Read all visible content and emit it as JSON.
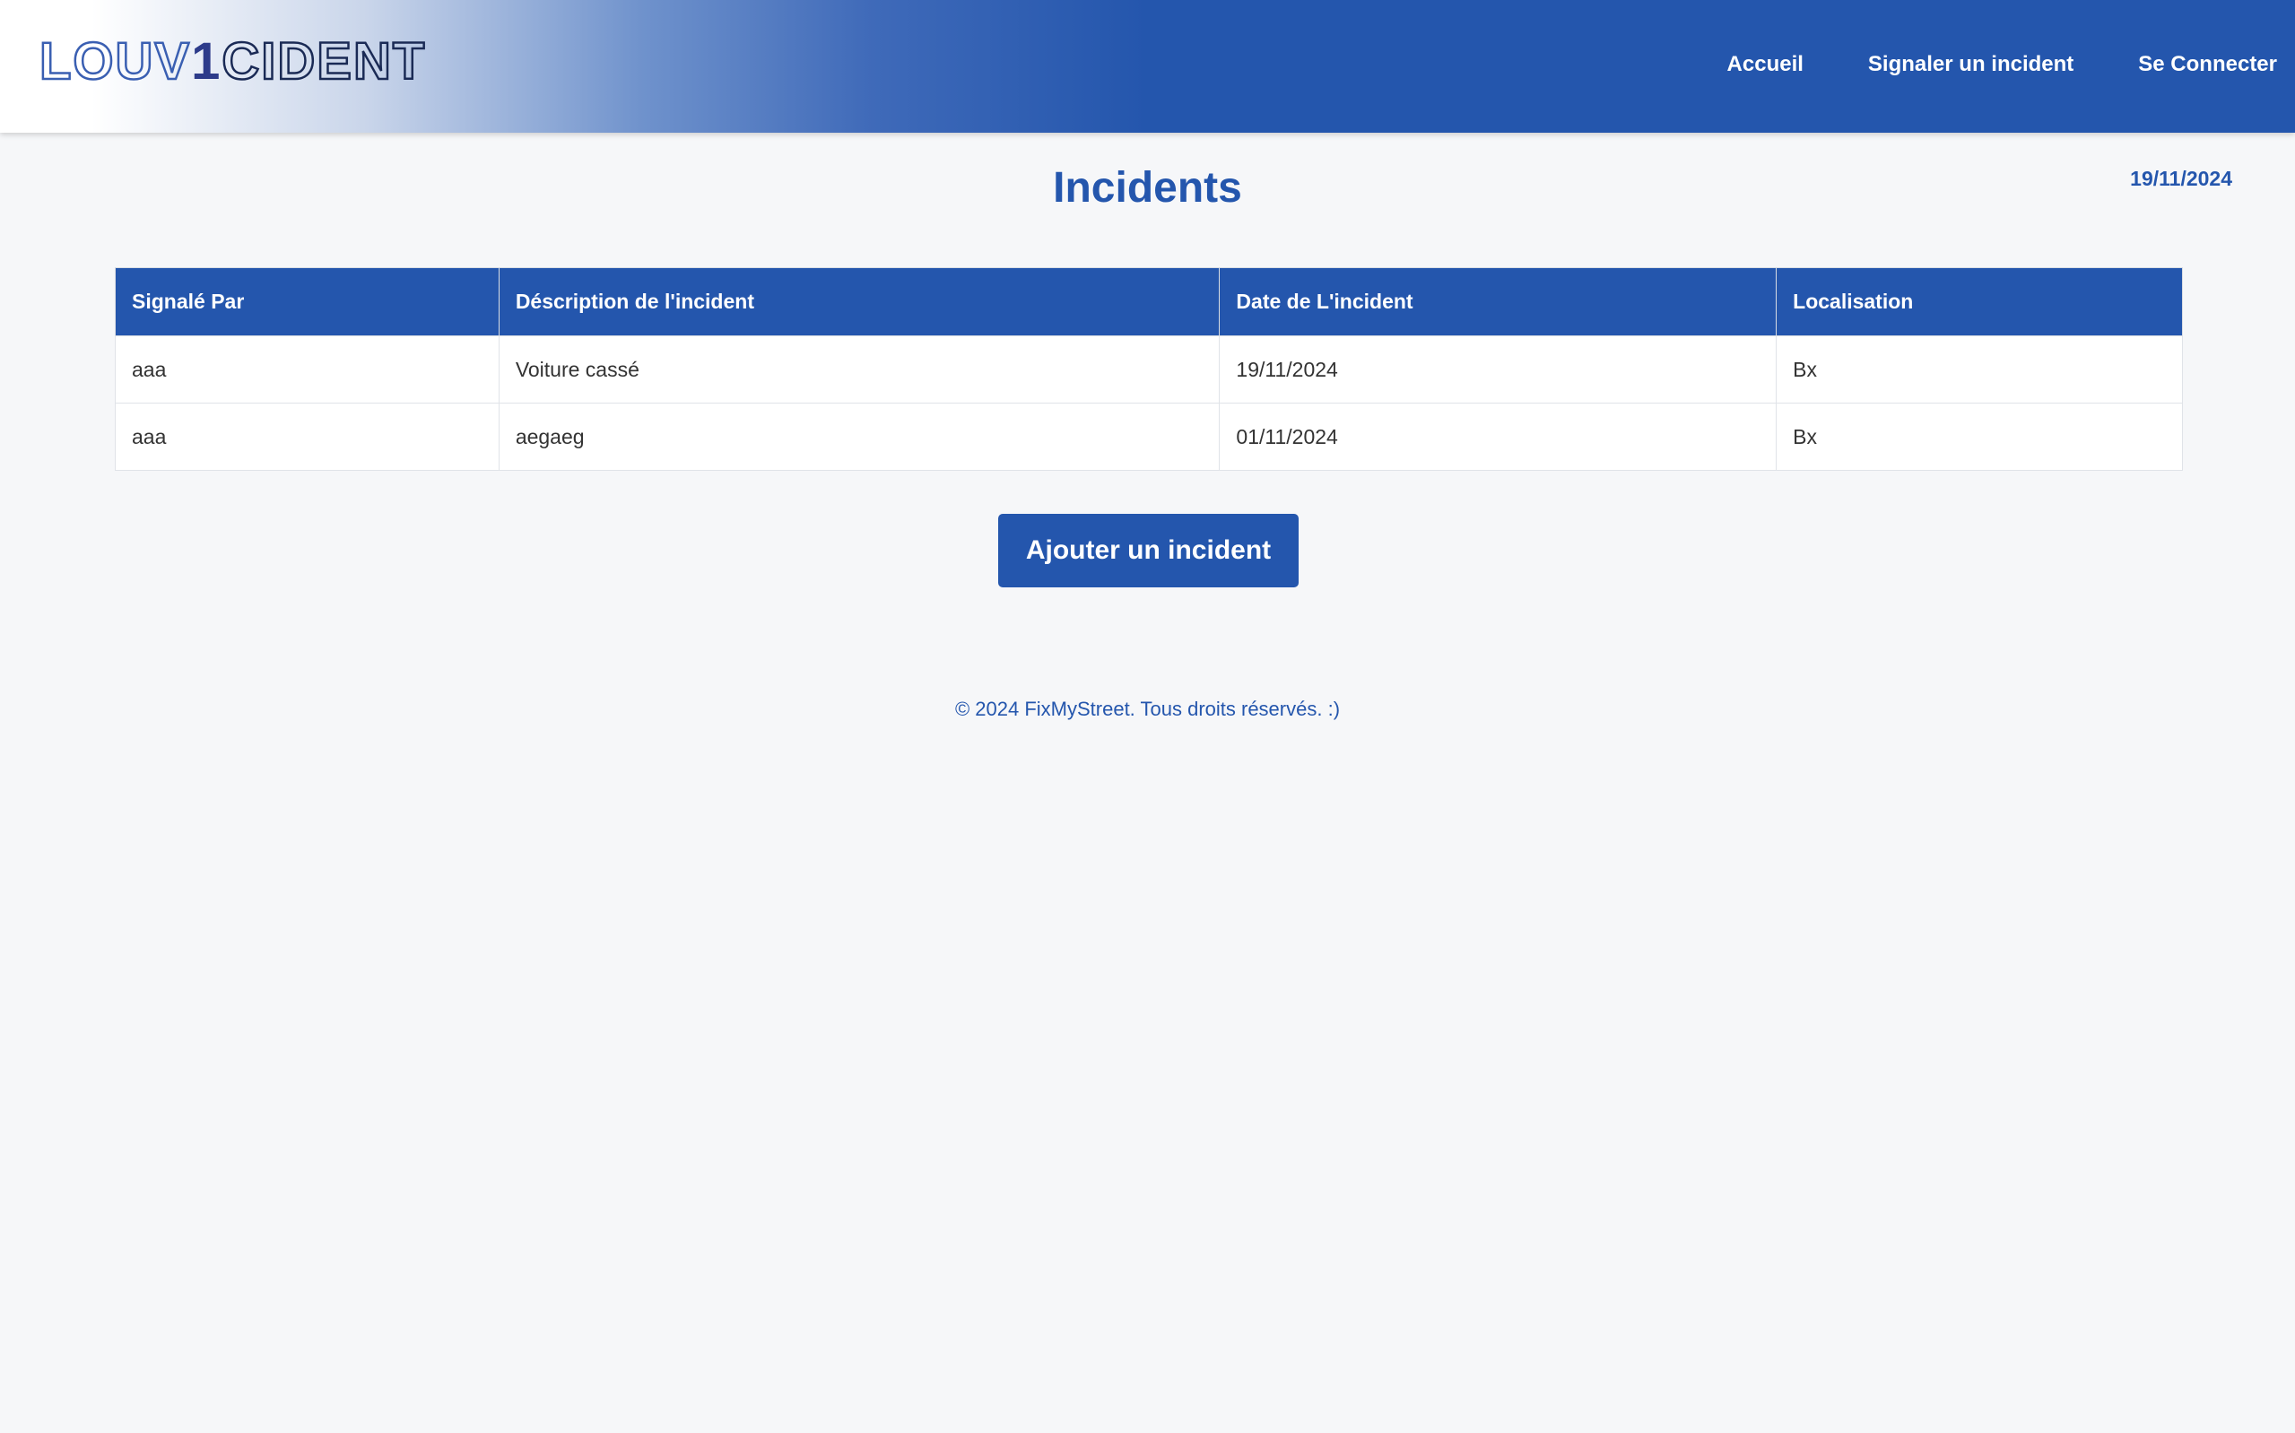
{
  "header": {
    "logo_text": "LOUV1CIDENT",
    "nav": {
      "home": "Accueil",
      "report": "Signaler un incident",
      "login": "Se Connecter"
    }
  },
  "main": {
    "title": "Incidents",
    "date": "19/11/2024",
    "table": {
      "headers": [
        "Signalé Par",
        "Déscription de l'incident",
        "Date de L'incident",
        "Localisation"
      ],
      "rows": [
        [
          "aaa",
          "Voiture cassé",
          "19/11/2024",
          "Bx"
        ],
        [
          "aaa",
          "aegaeg",
          "01/11/2024",
          "Bx"
        ]
      ]
    },
    "add_button": "Ajouter un incident"
  },
  "footer": {
    "text": "© 2024 FixMyStreet. Tous droits réservés. :)"
  },
  "colors": {
    "primary": "#2456ad",
    "background": "#f6f7f9"
  }
}
